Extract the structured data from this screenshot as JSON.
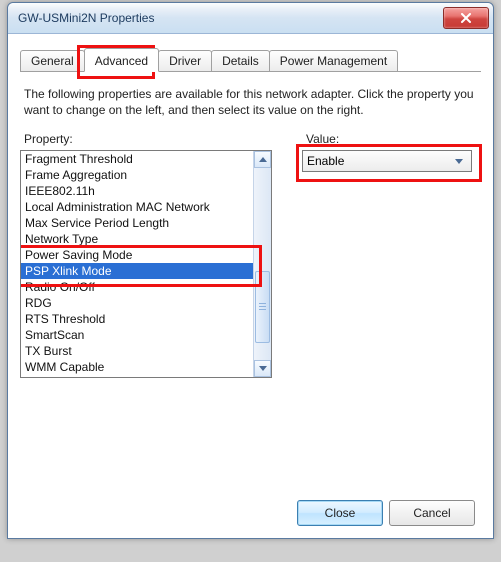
{
  "window": {
    "title": "GW-USMini2N Properties"
  },
  "tabs": {
    "general": "General",
    "advanced": "Advanced",
    "driver": "Driver",
    "details": "Details",
    "power": "Power Management"
  },
  "description": "The following properties are available for this network adapter. Click the property you want to change on the left, and then select its value on the right.",
  "property_label_pre": "P",
  "property_label_post": "roperty:",
  "value_label_pre": "V",
  "value_label_post": "alue:",
  "properties": [
    "Fragment Threshold",
    "Frame Aggregation",
    "IEEE802.11h",
    "Local Administration MAC Network",
    "Max Service Period Length",
    "Network Type",
    "Power Saving Mode",
    "PSP Xlink Mode",
    "Radio On/Off",
    "RDG",
    "RTS Threshold",
    "SmartScan",
    "TX Burst",
    "WMM Capable"
  ],
  "selected_property_index": 7,
  "value": {
    "selected": "Enable"
  },
  "buttons": {
    "close": "Close",
    "cancel": "Cancel"
  },
  "highlights": {
    "tab_advanced": true,
    "psp_xlink": true,
    "value_combo": true
  }
}
